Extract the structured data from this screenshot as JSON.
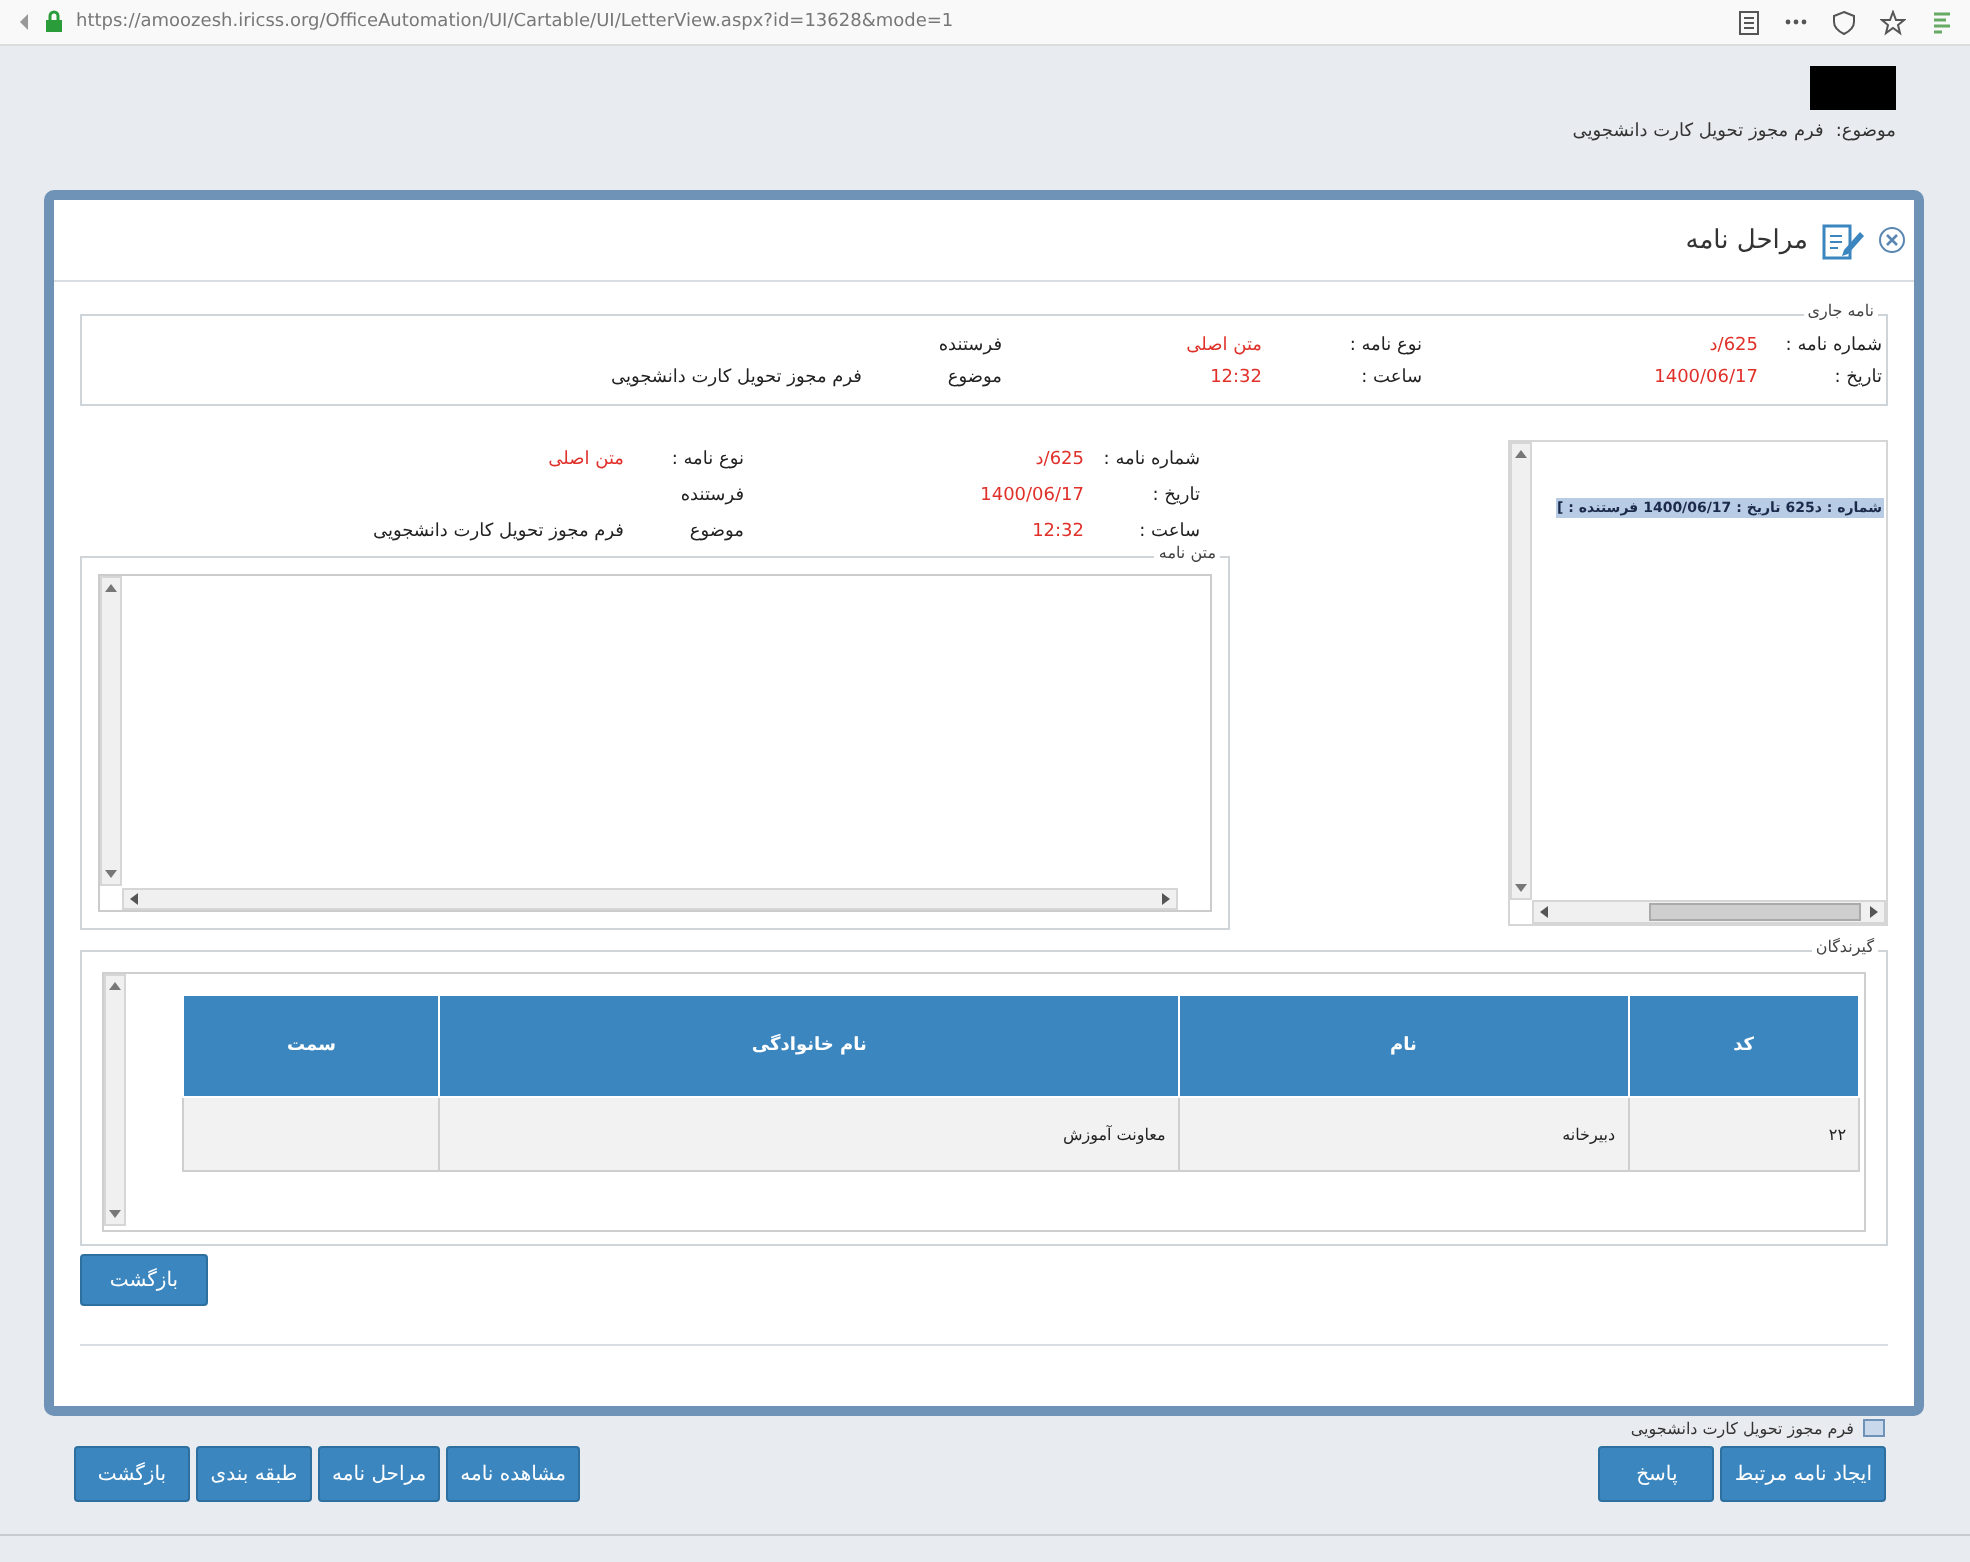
{
  "browser": {
    "url": "https://amoozesh.iricss.org/OfficeAutomation/UI/Cartable/UI/LetterView.aspx?id=13628&mode=1"
  },
  "page": {
    "subject_label": "موضوع:",
    "subject": "فرم مجوز تحویل کارت دانشجویی"
  },
  "dialog": {
    "title": "مراحل نامه",
    "current_letter": {
      "legend": "نامه جاری",
      "fields": [
        {
          "label": "شماره نامه :",
          "value": "625/د",
          "highlighted": true
        },
        {
          "label": "نوع نامه :",
          "value": "متن اصلی",
          "highlighted": true
        },
        {
          "label": "فرستنده"
        },
        {
          "label": "تاریخ :",
          "value": "1400/06/17",
          "highlighted": true
        },
        {
          "label": "ساعت :",
          "value": "12:32",
          "highlighted": true
        },
        {
          "label": "موضوع",
          "value": "فرم مجوز تحویل کارت دانشجویی",
          "highlighted": false
        }
      ]
    },
    "letter_list": {
      "items": [
        {
          "text": "شماره : د625 تاریخ : 1400/06/17 فرستنده : ]",
          "selected": true
        }
      ]
    },
    "letter_details": {
      "body_legend": "متن نامه",
      "fields": [
        {
          "label": "شماره نامه :",
          "value": "625/د",
          "highlighted": true
        },
        {
          "label": "نوع نامه :",
          "value": "متن اصلی",
          "highlighted": true
        },
        {
          "label": "تاریخ :",
          "value": "1400/06/17",
          "highlighted": true
        },
        {
          "label": "فرستنده"
        },
        {
          "label": "ساعت :",
          "value": "12:32",
          "highlighted": true
        },
        {
          "label": "موضوع",
          "value": "فرم مجوز تحویل کارت دانشجویی",
          "highlighted": false
        }
      ]
    },
    "recipients": {
      "legend": "گیرندگان",
      "columns": [
        "کد",
        "نام",
        "نام خانوادگی",
        "سمت"
      ],
      "rows": [
        [
          "۲۲",
          "دبیرخانه",
          "معاونت آموزش"
        ]
      ]
    },
    "back_button": "بازگشت"
  },
  "footer": {
    "subject": "فرم مجوز تحویل کارت دانشجویی",
    "right_buttons": [
      "ایجاد نامه مرتبط",
      "پاسخ"
    ],
    "left_buttons": [
      "مشاهده نامه",
      "مراحل نامه",
      "طبقه بندی",
      "بازگشت"
    ]
  }
}
